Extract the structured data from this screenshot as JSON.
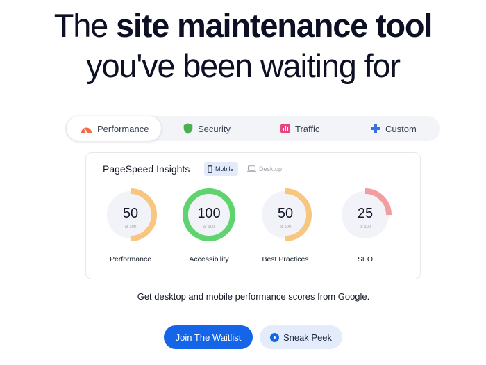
{
  "hero": {
    "line1_prefix": "The ",
    "line1_bold": "site maintenance tool",
    "line2": "you've been waiting for"
  },
  "tabs": [
    {
      "label": "Performance",
      "icon": "speedometer-icon",
      "color": "#ef6b4a",
      "active": true
    },
    {
      "label": "Security",
      "icon": "shield-icon",
      "color": "#4caf50",
      "active": false
    },
    {
      "label": "Traffic",
      "icon": "bar-chart-icon",
      "color": "#e8457c",
      "active": false
    },
    {
      "label": "Custom",
      "icon": "plus-icon",
      "color": "#3b6fe0",
      "active": false
    }
  ],
  "card": {
    "title": "PageSpeed Insights",
    "toggles": [
      {
        "label": "Mobile",
        "icon": "mobile-icon",
        "selected": true
      },
      {
        "label": "Desktop",
        "icon": "desktop-icon",
        "selected": false
      }
    ],
    "gauges": [
      {
        "value": "50",
        "sub": "of 100",
        "label": "Performance",
        "fraction": 0.5,
        "color": "#f8c67e"
      },
      {
        "value": "100",
        "sub": "of 100",
        "label": "Accessibility",
        "fraction": 1.0,
        "color": "#5fd46e"
      },
      {
        "value": "50",
        "sub": "of 100",
        "label": "Best Practices",
        "fraction": 0.5,
        "color": "#f8c67e"
      },
      {
        "value": "25",
        "sub": "of 100",
        "label": "SEO",
        "fraction": 0.25,
        "color": "#f29da0"
      }
    ]
  },
  "caption": "Get desktop and mobile performance scores from Google.",
  "buttons": {
    "waitlist": "Join The Waitlist",
    "peek": "Sneak Peek"
  },
  "colors": {
    "primary": "#1565e8",
    "secondary_bg": "#e4ebfb",
    "gauge_track": "#f2f3f8"
  }
}
